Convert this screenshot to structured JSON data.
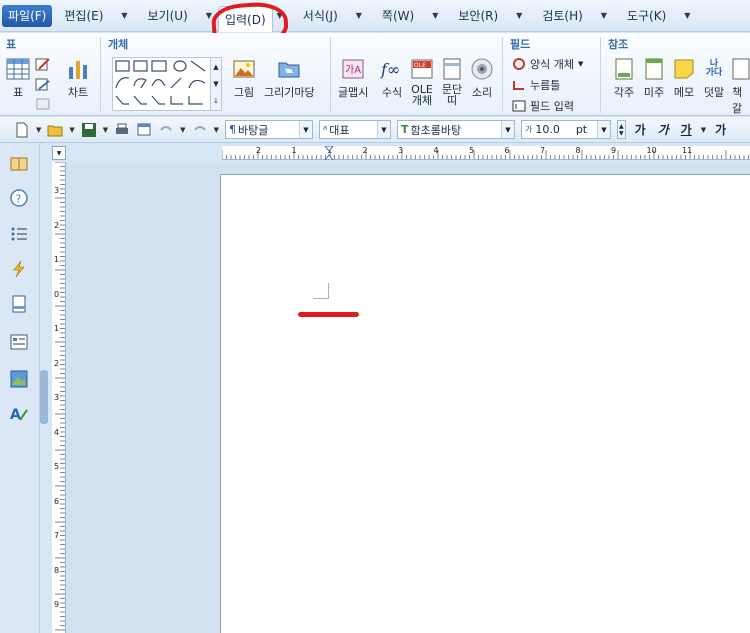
{
  "menu": {
    "items": [
      "파일(F)",
      "편집(E)",
      "보기(U)",
      "입력(D)",
      "서식(J)",
      "쪽(W)",
      "보안(R)",
      "검토(H)",
      "도구(K)"
    ],
    "active": "입력(D)"
  },
  "ribbon": {
    "group_table": "표",
    "group_object": "개체",
    "group_field": "필드",
    "group_reference": "참조",
    "table_label": "표",
    "chart_label": "차트",
    "picture_label": "그림",
    "drawing_label": "그리기마당",
    "glyph_label": "글맵시",
    "equation_label": "수식",
    "ole_label_1": "OLE",
    "ole_label_2": "개체",
    "paragraph_label_1": "문단",
    "paragraph_label_2": "띠",
    "sound_label": "소리",
    "form_object_label": "양식 개체",
    "button_label": "누름틀",
    "field_input_label": "필드 입력",
    "footnote_label": "각주",
    "endnote_label": "미주",
    "memo_label": "메모",
    "ruby_label": "덧말",
    "ruby_icon_text": "나\n가다",
    "bookmark_label": "책갈"
  },
  "toolbar": {
    "style_value": "바탕글",
    "outline_value": "대표",
    "font_value": "함초롬바탕",
    "size_value": "10.0",
    "size_unit": "pt",
    "bold_label": "가",
    "italic_label": "가",
    "underline_label": "가",
    "more_label": "가"
  },
  "ruler": {
    "h_labels": [
      "2",
      "1",
      "1",
      "2",
      "3",
      "4",
      "5",
      "6",
      "7",
      "8",
      "9",
      "10",
      "11"
    ],
    "v_labels": [
      "3",
      "2",
      "1",
      "0",
      "1",
      "2",
      "3",
      "4",
      "5",
      "6",
      "7",
      "8",
      "9",
      "10"
    ]
  },
  "colors": {
    "annotation": "#e01b22",
    "menu_active_file": "#2357a8"
  }
}
